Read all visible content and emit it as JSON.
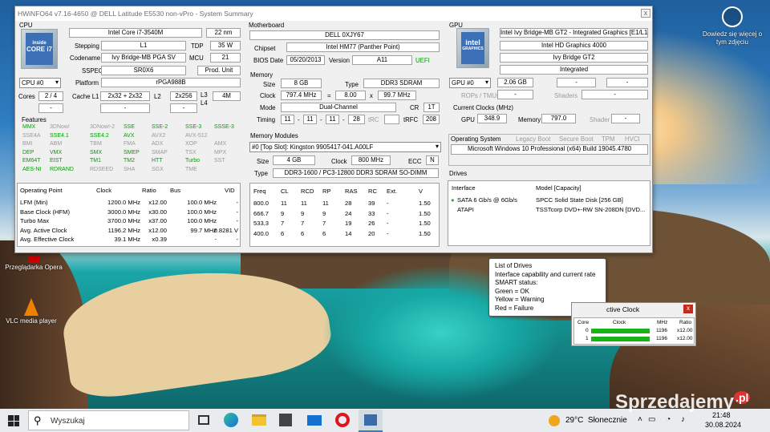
{
  "window": {
    "title": "HWiNFO64 v7.16-4650 @ DELL Latitude E5530 non-vPro - System Summary",
    "close": "x"
  },
  "cpu": {
    "section": "CPU",
    "name": "Intel Core i7-3540M",
    "nm": "22 nm",
    "stepping_label": "Stepping",
    "stepping": "L1",
    "tdp_label": "TDP",
    "tdp": "35 W",
    "codename_label": "Codename",
    "codename": "Ivy Bridge-MB PGA SV",
    "mcu_label": "MCU",
    "mcu": "21",
    "sspec_label": "SSPEC",
    "sspec": "SR0X6",
    "prod": "Prod. Unit",
    "selector": "CPU #0",
    "platform_label": "Platform",
    "platform": "rPGA988B",
    "cores_label": "Cores",
    "cores": "2 / 4",
    "cache_l1_label": "Cache L1",
    "cache_l1": "2x32 + 2x32",
    "l2_label": "L2",
    "l2": "2x256",
    "l3_label": "L3",
    "l4_label": "L4",
    "l3": "4M",
    "blank": "-",
    "logo": "CORE i7",
    "logo_sub": "inside"
  },
  "features": {
    "label": "Features",
    "rows": [
      [
        [
          "MMX",
          "g"
        ],
        [
          "3DNow!",
          "gr"
        ],
        [
          "3DNow!-2",
          "gr"
        ],
        [
          "SSE",
          "g"
        ],
        [
          "SSE-2",
          "g"
        ],
        [
          "SSE-3",
          "g"
        ],
        [
          "SSSE-3",
          "g"
        ]
      ],
      [
        [
          "SSE4A",
          "gr"
        ],
        [
          "SSE4.1",
          "g"
        ],
        [
          "SSE4.2",
          "g"
        ],
        [
          "AVX",
          "g"
        ],
        [
          "AVX2",
          "gr"
        ],
        [
          "AVX-512",
          "gr"
        ]
      ],
      [
        [
          "BMI",
          "gr"
        ],
        [
          "ABM",
          "gr"
        ],
        [
          "TBM",
          "gr"
        ],
        [
          "FMA",
          "gr"
        ],
        [
          "ADX",
          "gr"
        ],
        [
          "XOP",
          "gr"
        ],
        [
          "AMX",
          "gr"
        ]
      ],
      [
        [
          "DEP",
          "g"
        ],
        [
          "VMX",
          "g"
        ],
        [
          "SMX",
          "g"
        ],
        [
          "SMEP",
          "g"
        ],
        [
          "SMAP",
          "gr"
        ],
        [
          "TSX",
          "gr"
        ],
        [
          "MPX",
          "gr"
        ]
      ],
      [
        [
          "EM64T",
          "g"
        ],
        [
          "EIST",
          "g"
        ],
        [
          "TM1",
          "g"
        ],
        [
          "TM2",
          "g"
        ],
        [
          "HTT",
          "g"
        ],
        [
          "Turbo",
          "g"
        ],
        [
          "SST",
          "gr"
        ]
      ],
      [
        [
          "AES-NI",
          "g"
        ],
        [
          "RDRAND",
          "g"
        ],
        [
          "RDSEED",
          "gr"
        ],
        [
          "SHA",
          "gr"
        ],
        [
          "SGX",
          "gr"
        ],
        [
          "TME",
          "gr"
        ]
      ]
    ]
  },
  "op": {
    "headers": [
      "Operating Point",
      "Clock",
      "Ratio",
      "Bus",
      "VID"
    ],
    "rows": [
      [
        "LFM (Min)",
        "1200.0 MHz",
        "x12.00",
        "100.0 MHz",
        "-"
      ],
      [
        "Base Clock (HFM)",
        "3000.0 MHz",
        "x30.00",
        "100.0 MHz",
        "-"
      ],
      [
        "Turbo Max",
        "3700.0 MHz",
        "x37.00",
        "100.0 MHz",
        "-"
      ],
      [
        "Avg. Active Clock",
        "1196.2 MHz",
        "x12.00",
        "99.7 MHz",
        "0.8281 V"
      ],
      [
        "Avg. Effective Clock",
        "39.1 MHz",
        "x0.39",
        "-",
        "-"
      ]
    ]
  },
  "mb": {
    "section": "Motherboard",
    "name": "DELL 0XJY67",
    "chipset_label": "Chipset",
    "chipset": "Intel HM77 (Panther Point)",
    "bios_label": "BIOS Date",
    "bios": "05/20/2013",
    "version_label": "Version",
    "version": "A11",
    "uefi": "UEFI"
  },
  "mem": {
    "section": "Memory",
    "size_label": "Size",
    "size": "8 GB",
    "type_label": "Type",
    "type": "DDR3 SDRAM",
    "clock_label": "Clock",
    "clock": "797.4 MHz",
    "eq": "=",
    "mult": "8.00",
    "x": "x",
    "bus": "99.7 MHz",
    "mode_label": "Mode",
    "mode": "Dual-Channel",
    "cr_label": "CR",
    "cr": "1T",
    "timing_label": "Timing",
    "t1": "11",
    "t2": "11",
    "t3": "11",
    "t4": "28",
    "trc_label": "tRC",
    "trfc_label": "tRFC",
    "trfc": "208",
    "dash": "-"
  },
  "modules": {
    "section": "Memory Modules",
    "selected": "#0 [Top Slot]: Kingston 9905417-041.A00LF",
    "size_label": "Size",
    "size": "4 GB",
    "clock_label": "Clock",
    "clock": "800 MHz",
    "ecc_label": "ECC",
    "ecc": "N",
    "type_label": "Type",
    "type": "DDR3-1600 / PC3-12800 DDR3 SDRAM SO-DIMM",
    "headers": [
      "Freq",
      "CL",
      "RCD",
      "RP",
      "RAS",
      "RC",
      "Ext.",
      "V"
    ],
    "rows": [
      [
        "800.0",
        "11",
        "11",
        "11",
        "28",
        "39",
        "-",
        "1.50"
      ],
      [
        "666.7",
        "9",
        "9",
        "9",
        "24",
        "33",
        "-",
        "1.50"
      ],
      [
        "533.3",
        "7",
        "7",
        "7",
        "19",
        "26",
        "-",
        "1.50"
      ],
      [
        "400.0",
        "6",
        "6",
        "6",
        "14",
        "20",
        "-",
        "1.50"
      ]
    ]
  },
  "gpu": {
    "section": "GPU",
    "name": "Intel Ivy Bridge-MB GT2 - Integrated Graphics [E1/L1]",
    "model": "Intel HD Graphics 4000",
    "arch": "Ivy Bridge GT2",
    "type": "Integrated",
    "selector": "GPU #0",
    "vram": "2.06 GB",
    "rops_label": "ROPs / TMUs",
    "shaders_label": "Shaders",
    "clocks_label": "Current Clocks (MHz)",
    "gpu_label": "GPU",
    "gpu_clock": "348.9",
    "memory_label": "Memory",
    "mem_clock": "797.0",
    "shader_label": "Shader",
    "blank": "-",
    "logo": "intel",
    "logo_sub": "GRAPHICS"
  },
  "os": {
    "section": "Operating System",
    "legacy": "Legacy Boot",
    "secure": "Secure Boot",
    "tpm": "TPM",
    "hvci": "HVCI",
    "name": "Microsoft Windows 10 Professional (x64) Build 19045.4780"
  },
  "drives": {
    "section": "Drives",
    "headers": [
      "Interface",
      "Model [Capacity]"
    ],
    "rows": [
      [
        "SATA 6 Gb/s @ 6Gb/s",
        "SPCC Solid State Disk [256 GB]"
      ],
      [
        "ATAPI",
        "TSSTcorp DVD+-RW SN-208DN [DVD..."
      ]
    ]
  },
  "tooltip": [
    "List of Drives",
    "Interface capability and current rate",
    "SMART status:",
    "Green = OK",
    "Yellow = Warning",
    "Red = Failure"
  ],
  "clockwin": {
    "title": "ctive Clock",
    "headers": [
      "Core",
      "Clock",
      "MHz",
      "Ratio"
    ],
    "rows": [
      [
        "0",
        "1196",
        "x12.00"
      ],
      [
        "1",
        "1196",
        "x12.00"
      ]
    ],
    "close": "x"
  },
  "desktop": {
    "opera": "Przeglądarka Opera",
    "vlc": "VLC media player",
    "lens": "Dowiedz się więcej o tym zdjęciu"
  },
  "taskbar": {
    "search": "Wyszukaj",
    "weather": "29°C  Słonecznie",
    "time": "21:48",
    "date": "30.08.2024",
    "watermark": "Sprzedajemy",
    "wm_pl": ".pl"
  }
}
